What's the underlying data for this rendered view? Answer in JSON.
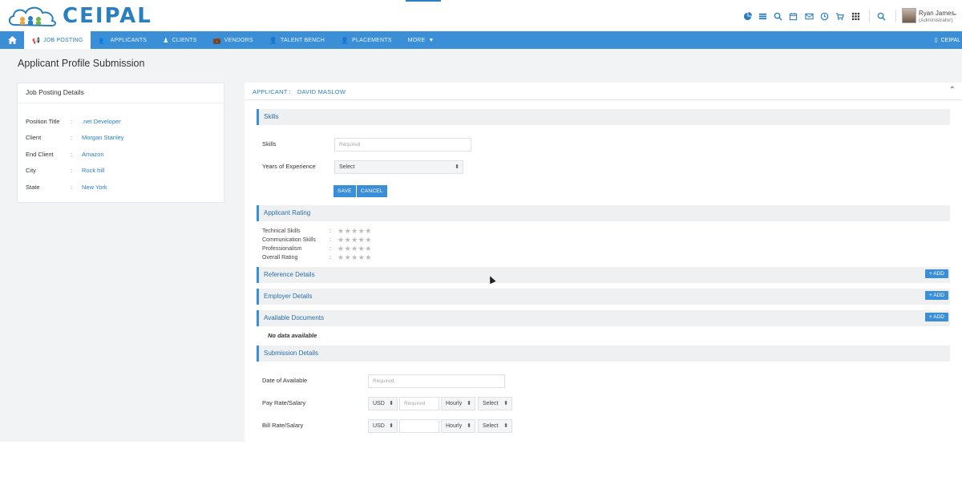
{
  "brand": {
    "name": "CEIPAL",
    "accent": "#2a7fbf",
    "nav_color": "#3a8fd6"
  },
  "header": {
    "icons": [
      "pie-chart-icon",
      "list-icon",
      "search-plus-icon",
      "calendar-icon",
      "mail-icon",
      "clock-icon",
      "cart-icon",
      "grid-icon",
      "search-icon",
      "plus-icon"
    ],
    "user": {
      "name": "Ryan James",
      "role": "(Administrator)"
    }
  },
  "nav": {
    "items": [
      {
        "label": "JOB POSTING",
        "icon": "megaphone-icon",
        "active": true
      },
      {
        "label": "APPLICANTS",
        "icon": "users-icon",
        "active": false
      },
      {
        "label": "CLIENTS",
        "icon": "person-icon",
        "active": false
      },
      {
        "label": "VENDORS",
        "icon": "briefcase-icon",
        "active": false
      },
      {
        "label": "TALENT BENCH",
        "icon": "user-group-icon",
        "active": false
      },
      {
        "label": "PLACEMENTS",
        "icon": "user-plus-icon",
        "active": false
      },
      {
        "label": "MORE",
        "icon": "caret-down-icon",
        "active": false
      }
    ],
    "right_label": "CEIPAL"
  },
  "page": {
    "title": "Applicant Profile Submission"
  },
  "job_posting": {
    "header": "Job Posting Details",
    "fields": [
      {
        "label": "Position Title",
        "value": ".net Developer"
      },
      {
        "label": "Client",
        "value": "Morgan Stanley"
      },
      {
        "label": "End Client",
        "value": "Amazon"
      },
      {
        "label": "City",
        "value": "Rock hill"
      },
      {
        "label": "State",
        "value": "New York"
      }
    ],
    "separator": ":"
  },
  "applicant": {
    "label": "APPLICANT :",
    "name": "DAVID MASLOW"
  },
  "skills": {
    "section_title": "Skills",
    "skills_label": "Skills",
    "skills_placeholder": "Required",
    "experience_label": "Years of Experience",
    "experience_value": "Select",
    "save_label": "SAVE",
    "cancel_label": "CANCEL"
  },
  "rating": {
    "section_title": "Applicant Rating",
    "items": [
      {
        "label": "Technical Skills",
        "stars": 0
      },
      {
        "label": "Communication Skills",
        "stars": 0
      },
      {
        "label": "Professionalism",
        "stars": 0
      },
      {
        "label": "Overall Rating",
        "stars": 0
      }
    ],
    "max_stars": 5
  },
  "sections": {
    "reference": "Reference Details",
    "employer": "Employer Details",
    "documents": "Available Documents",
    "no_data": "No data available",
    "add_label": "+ ADD",
    "submission": "Submission Details"
  },
  "submission": {
    "date_label": "Date of Available",
    "date_placeholder": "Required",
    "pay_label": "Pay Rate/Salary",
    "pay_currency": "USD",
    "pay_placeholder": "Required",
    "pay_period": "Hourly",
    "pay_type": "Select",
    "bill_label": "Bill Rate/Salary",
    "bill_currency": "USD",
    "bill_period": "Hourly",
    "bill_type": "Select"
  }
}
